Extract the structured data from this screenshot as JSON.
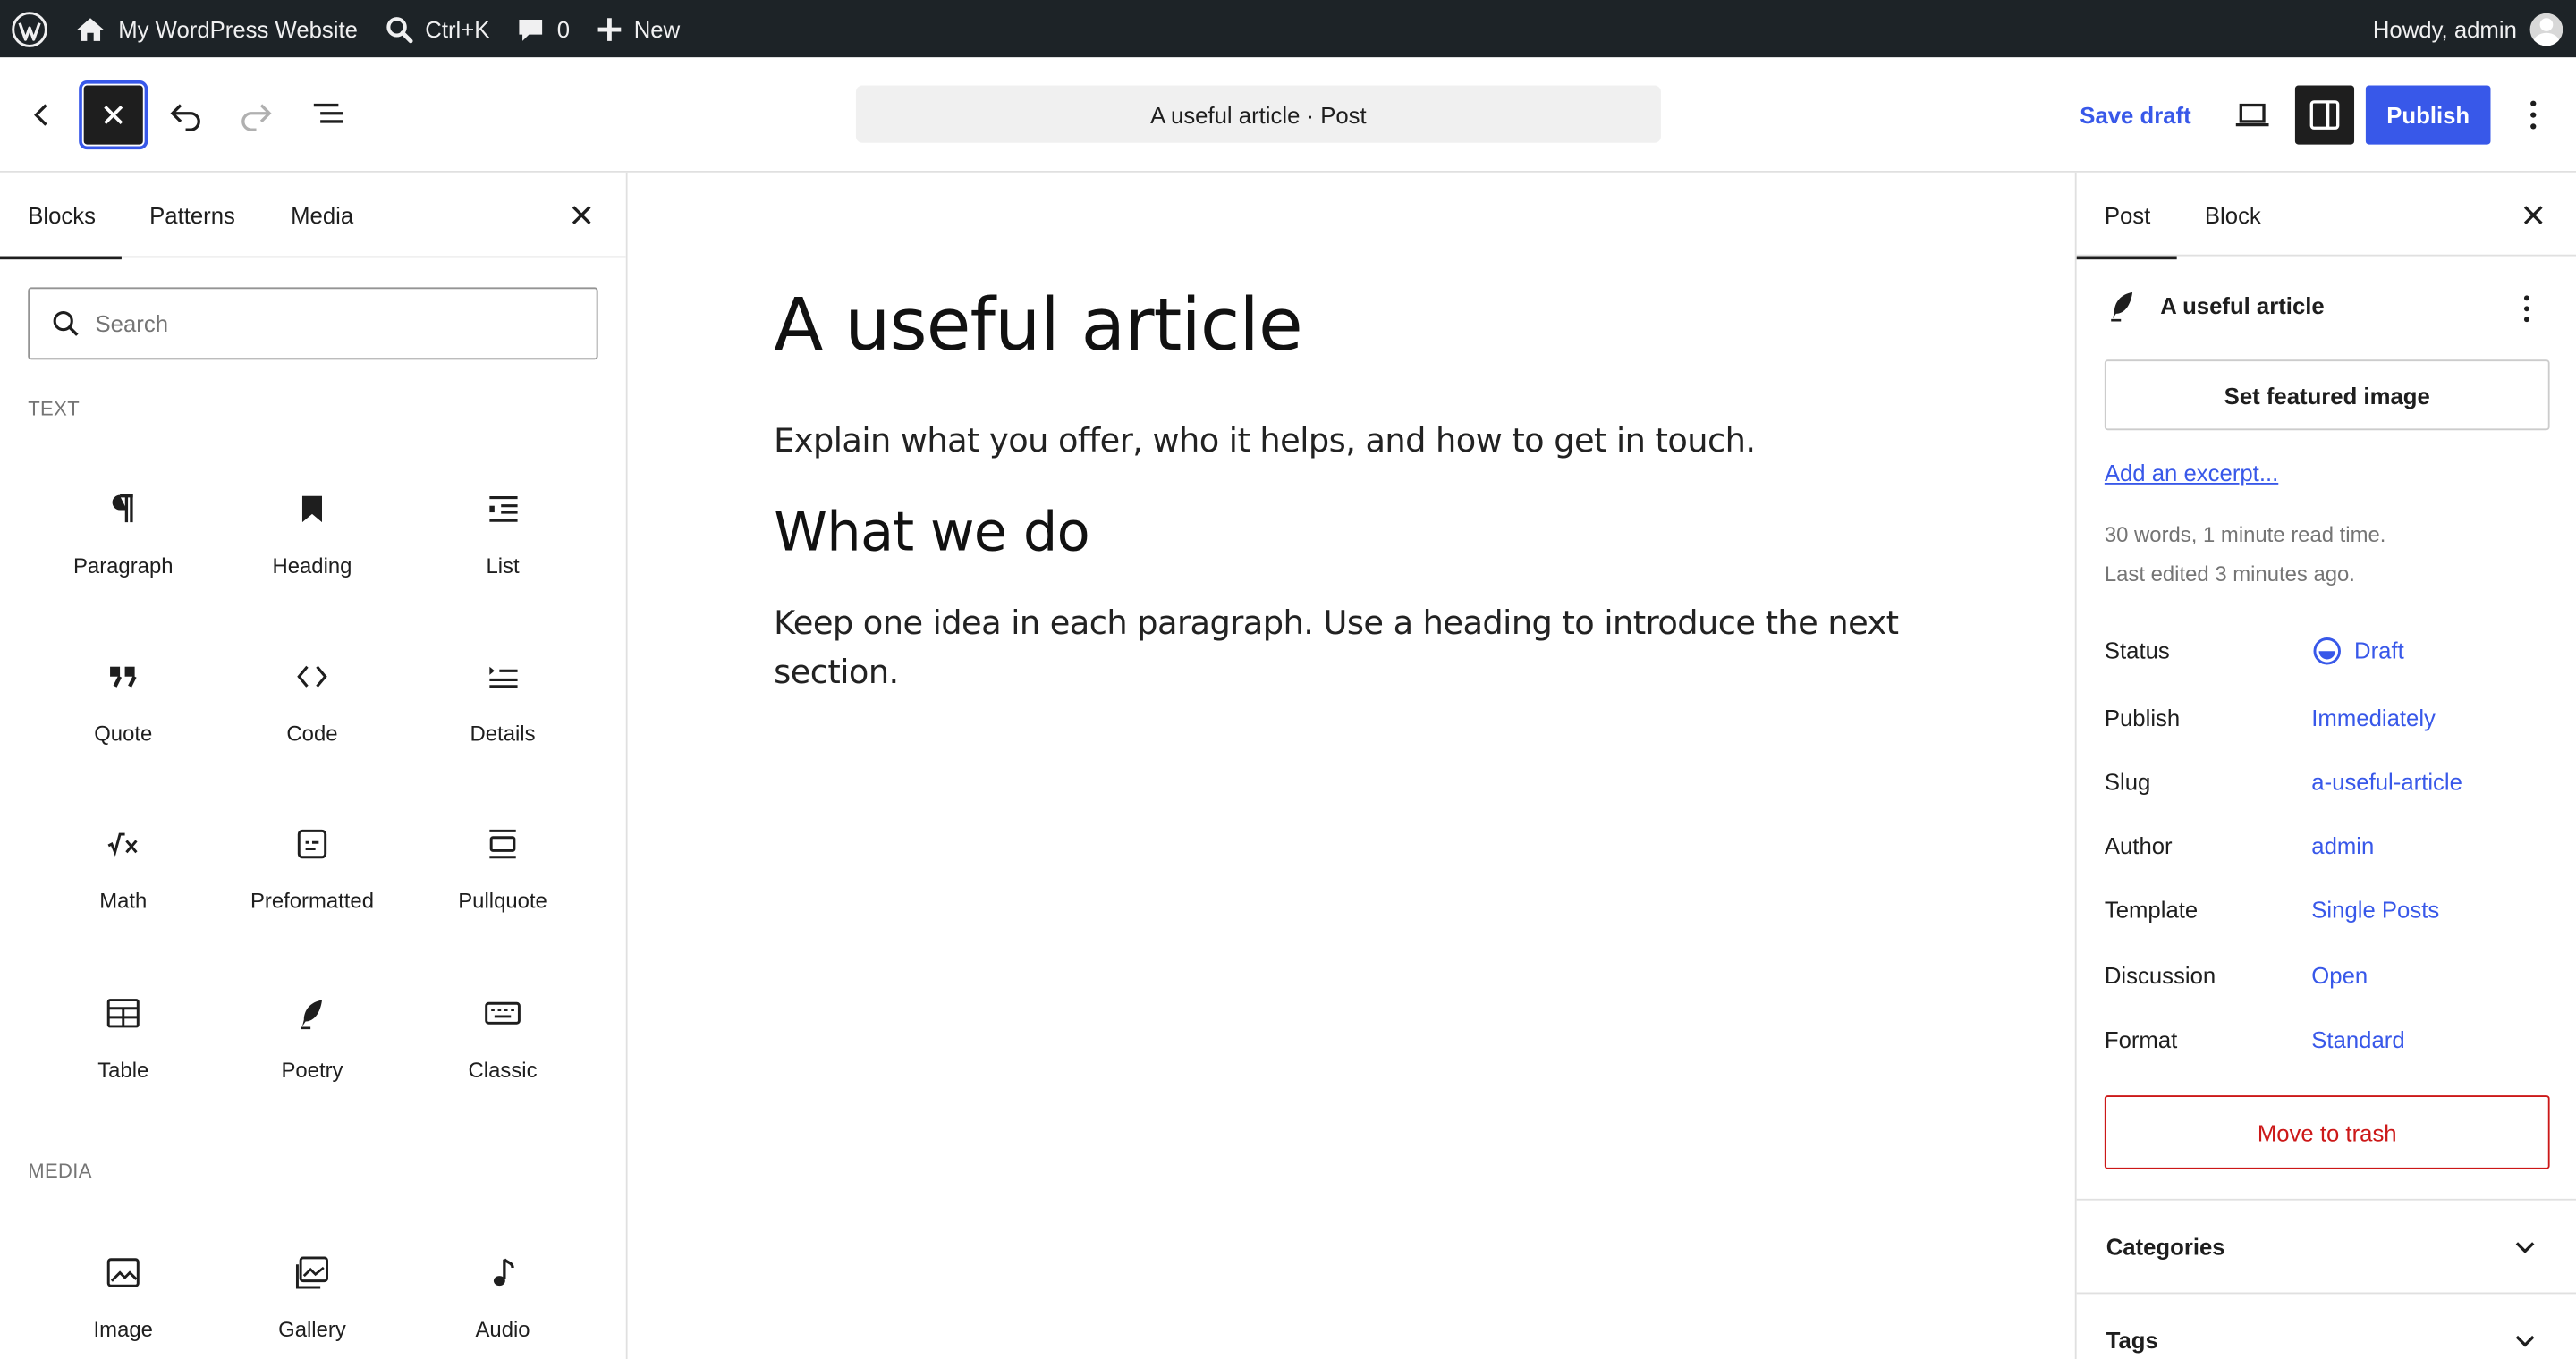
{
  "admin_bar": {
    "site_name": "My WordPress Website",
    "search_shortcut": "Ctrl+K",
    "comments_count": "0",
    "new_label": "New",
    "greeting": "Howdy, admin"
  },
  "header": {
    "document_title": "A useful article · Post",
    "save_draft_label": "Save draft",
    "publish_label": "Publish"
  },
  "inserter": {
    "tabs": [
      "Blocks",
      "Patterns",
      "Media"
    ],
    "search_placeholder": "Search",
    "categories": [
      {
        "name": "TEXT",
        "blocks": [
          {
            "label": "Paragraph",
            "icon": "paragraph-icon"
          },
          {
            "label": "Heading",
            "icon": "heading-icon"
          },
          {
            "label": "List",
            "icon": "list-icon"
          },
          {
            "label": "Quote",
            "icon": "quote-icon"
          },
          {
            "label": "Code",
            "icon": "code-icon"
          },
          {
            "label": "Details",
            "icon": "details-icon"
          },
          {
            "label": "Math",
            "icon": "math-icon"
          },
          {
            "label": "Preformatted",
            "icon": "preformatted-icon"
          },
          {
            "label": "Pullquote",
            "icon": "pullquote-icon"
          },
          {
            "label": "Table",
            "icon": "table-icon"
          },
          {
            "label": "Poetry",
            "icon": "poetry-icon"
          },
          {
            "label": "Classic",
            "icon": "classic-icon"
          }
        ]
      },
      {
        "name": "MEDIA",
        "blocks": [
          {
            "label": "Image",
            "icon": "image-icon"
          },
          {
            "label": "Gallery",
            "icon": "gallery-icon"
          },
          {
            "label": "Audio",
            "icon": "audio-icon"
          }
        ]
      }
    ]
  },
  "canvas": {
    "title": "A useful article",
    "intro": "Explain what you offer, who it helps, and how to get in touch.",
    "subheading": "What we do",
    "body": "Keep one idea in each paragraph. Use a heading to introduce the next section."
  },
  "settings": {
    "tabs": [
      "Post",
      "Block"
    ],
    "post_title": "A useful article",
    "featured_image_label": "Set featured image",
    "excerpt_link": "Add an excerpt...",
    "word_count": "30 words, 1 minute read time.",
    "last_edited": "Last edited 3 minutes ago.",
    "rows": [
      {
        "label": "Status",
        "value": "Draft"
      },
      {
        "label": "Publish",
        "value": "Immediately"
      },
      {
        "label": "Slug",
        "value": "a-useful-article"
      },
      {
        "label": "Author",
        "value": "admin"
      },
      {
        "label": "Template",
        "value": "Single Posts"
      },
      {
        "label": "Discussion",
        "value": "Open"
      },
      {
        "label": "Format",
        "value": "Standard"
      }
    ],
    "trash_label": "Move to trash",
    "panels": [
      "Categories",
      "Tags"
    ]
  },
  "colors": {
    "accent": "#3858e9",
    "admin_bar": "#1d2327",
    "danger": "#cc1818"
  }
}
